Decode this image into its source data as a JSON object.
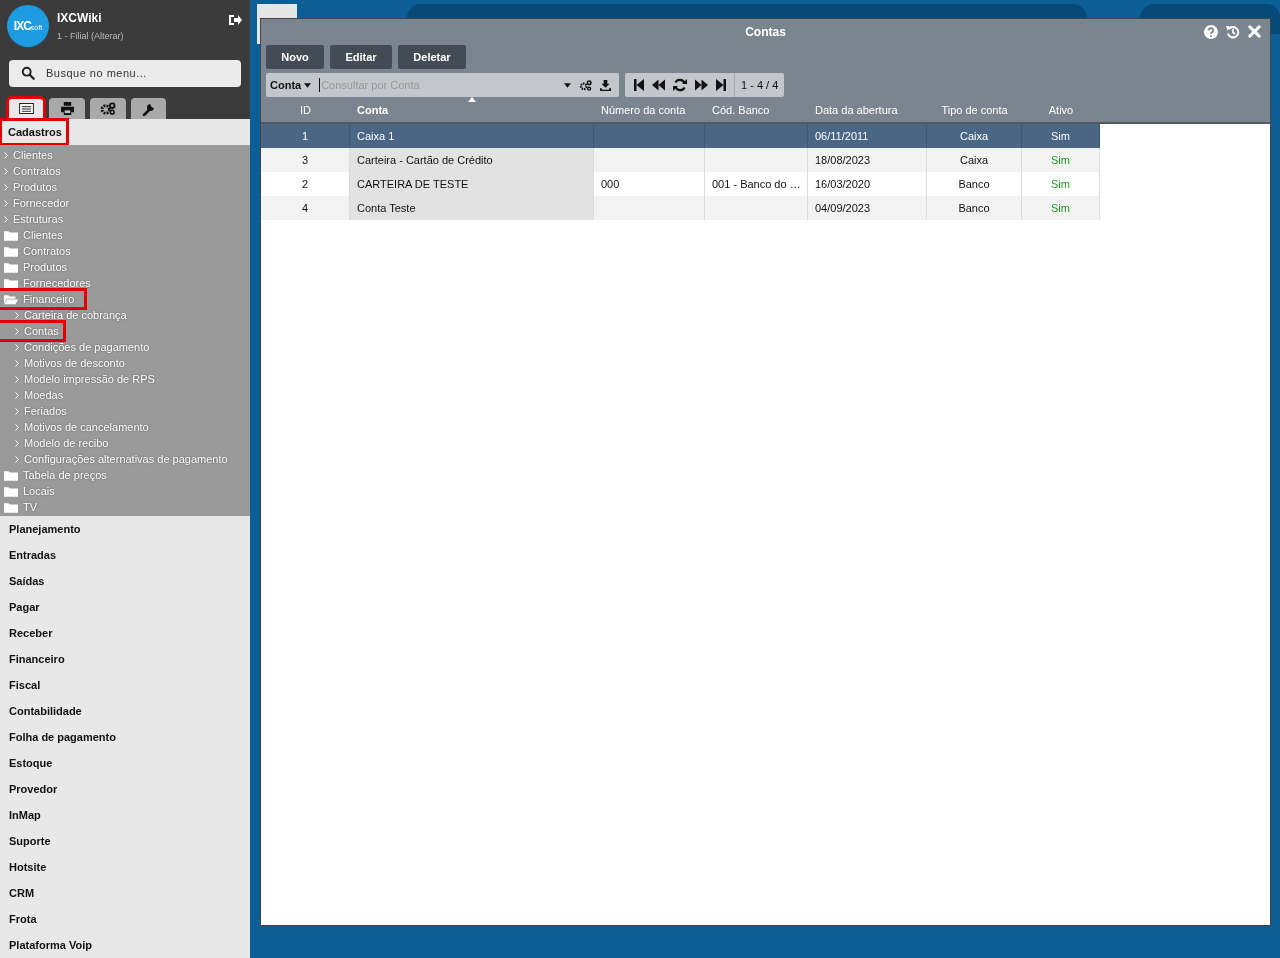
{
  "sidebar": {
    "brand": "IXCWiki",
    "logo": {
      "main": "IXC",
      "sub": "soft"
    },
    "branch": "1 - Filial (Alterar)",
    "search": {
      "placeholder": "Busque no menu..."
    },
    "tabs": [
      {
        "kind": "list",
        "selected": true,
        "highlighted": true
      },
      {
        "kind": "print",
        "selected": false,
        "highlighted": false
      },
      {
        "kind": "gears",
        "selected": false,
        "highlighted": false
      },
      {
        "kind": "wrench",
        "selected": false,
        "highlighted": false
      }
    ],
    "section": {
      "label": "Cadastros",
      "highlighted": true,
      "expanded": true
    },
    "tree": [
      {
        "kind": "link",
        "label": "Clientes",
        "highlighted": false
      },
      {
        "kind": "link",
        "label": "Contratos",
        "highlighted": false
      },
      {
        "kind": "link",
        "label": "Produtos",
        "highlighted": false
      },
      {
        "kind": "link",
        "label": "Fornecedor",
        "highlighted": false
      },
      {
        "kind": "link",
        "label": "Estruturas",
        "highlighted": false
      },
      {
        "kind": "folder",
        "label": "Clientes",
        "expanded": false,
        "highlighted": false
      },
      {
        "kind": "folder",
        "label": "Contratos",
        "expanded": false,
        "highlighted": false
      },
      {
        "kind": "folder",
        "label": "Produtos",
        "expanded": false,
        "highlighted": false
      },
      {
        "kind": "folder",
        "label": "Fornecedores",
        "expanded": false,
        "highlighted": false
      },
      {
        "kind": "folder",
        "label": "Financeiro",
        "expanded": true,
        "highlighted": true,
        "children": [
          {
            "kind": "link",
            "label": "Carteira de cobrança",
            "highlighted": false
          },
          {
            "kind": "link",
            "label": "Contas",
            "highlighted": true
          },
          {
            "kind": "link",
            "label": "Condições de pagamento",
            "highlighted": false
          },
          {
            "kind": "link",
            "label": "Motivos de desconto",
            "highlighted": false
          },
          {
            "kind": "link",
            "label": "Modelo impressão de RPS",
            "highlighted": false
          },
          {
            "kind": "link",
            "label": "Moedas",
            "highlighted": false
          },
          {
            "kind": "link",
            "label": "Feriados",
            "highlighted": false
          },
          {
            "kind": "link",
            "label": "Motivos de cancelamento",
            "highlighted": false
          },
          {
            "kind": "link",
            "label": "Modelo de recibo",
            "highlighted": false
          },
          {
            "kind": "link",
            "label": "Configurações alternativas de pagamento",
            "highlighted": false
          }
        ]
      },
      {
        "kind": "folder",
        "label": "Tabela de preços",
        "expanded": false,
        "highlighted": false
      },
      {
        "kind": "folder",
        "label": "Locais",
        "expanded": false,
        "highlighted": false
      },
      {
        "kind": "folder",
        "label": "TV",
        "expanded": false,
        "highlighted": false
      }
    ],
    "menu": [
      "Planejamento",
      "Entradas",
      "Saídas",
      "Pagar",
      "Receber",
      "Financeiro",
      "Fiscal",
      "Contabilidade",
      "Folha de pagamento",
      "Estoque",
      "Provedor",
      "InMap",
      "Suporte",
      "Hotsite",
      "CRM",
      "Frota",
      "Plataforma Voip"
    ]
  },
  "window": {
    "title": "Contas",
    "buttons": [
      "Novo",
      "Editar",
      "Deletar"
    ],
    "filter": {
      "field": "Conta",
      "placeholder": "Consultar por Conta"
    },
    "pager": "1 - 4 / 4",
    "table": {
      "columns": [
        {
          "label": "ID",
          "sorted": false
        },
        {
          "label": "Conta",
          "sorted": true
        },
        {
          "label": "Número da conta",
          "sorted": false
        },
        {
          "label": "Cód. Banco",
          "sorted": false
        },
        {
          "label": "Data da abertura",
          "sorted": false
        },
        {
          "label": "Tipo de conta",
          "sorted": false
        },
        {
          "label": "Ativo",
          "sorted": false
        }
      ],
      "rows": [
        {
          "selected": true,
          "cells": [
            "1",
            "Caixa 1",
            "",
            "",
            "06/11/2011",
            "Caixa",
            "Sim"
          ]
        },
        {
          "selected": false,
          "cells": [
            "3",
            "Carteira - Cartão de Crédito",
            "",
            "",
            "18/08/2023",
            "Caixa",
            "Sim"
          ]
        },
        {
          "selected": false,
          "cells": [
            "2",
            "CARTEIRA DE TESTE",
            "000",
            "001 - Banco do …",
            "16/03/2020",
            "Banco",
            "Sim"
          ]
        },
        {
          "selected": false,
          "cells": [
            "4",
            "Conta Teste",
            "",
            "",
            "04/09/2023",
            "Banco",
            "Sim"
          ]
        }
      ]
    }
  }
}
